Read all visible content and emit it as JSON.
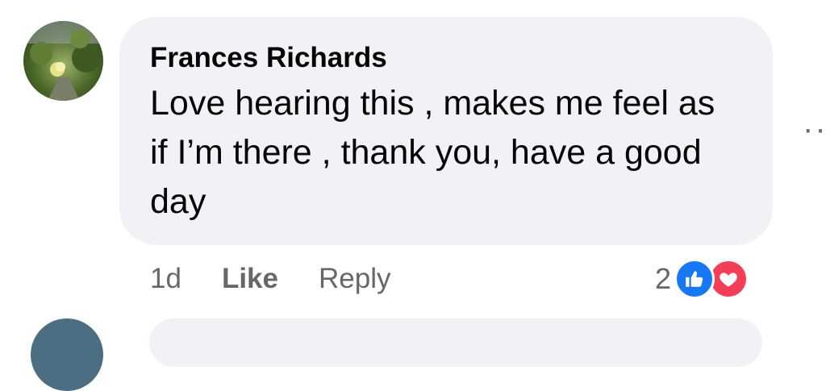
{
  "comment": {
    "author": "Frances Richards",
    "text": "Love hearing this , makes me feel as if I’m there , thank you, have a good day",
    "avatar_icon": "profile-photo",
    "more_options_icon": "ellipsis-icon"
  },
  "actions": {
    "time": "1d",
    "like_label": "Like",
    "reply_label": "Reply"
  },
  "reactions": {
    "count": "2",
    "icons": [
      "like-reaction-icon",
      "love-reaction-icon"
    ],
    "like_color": "#1877f2",
    "love_color": "#f33e58"
  },
  "colors": {
    "bubble_bg": "#f0f2f5",
    "muted_text": "#65676b",
    "primary_text": "#050505"
  }
}
